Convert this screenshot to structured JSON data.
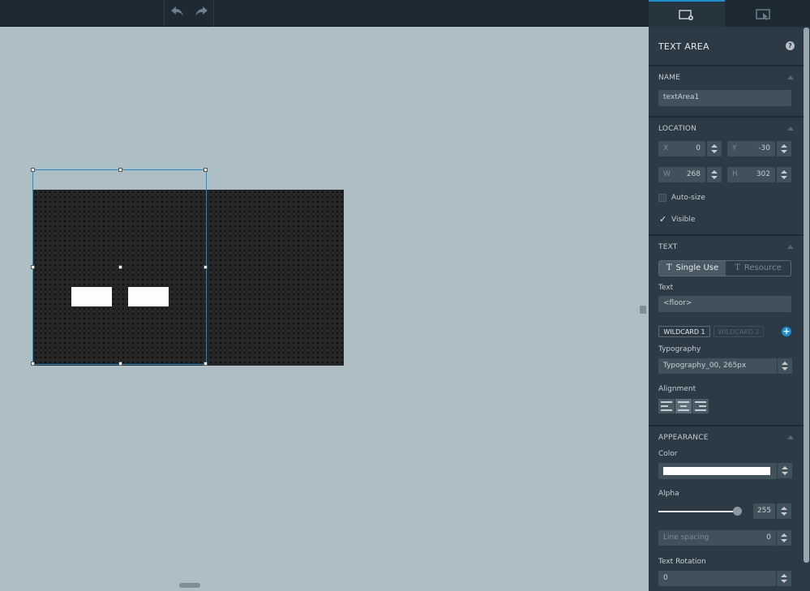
{
  "toolbar": {
    "undo_icon": "undo-arrow",
    "redo_icon": "redo-arrow"
  },
  "panel": {
    "tabs": [
      {
        "icon": "screen-settings-icon",
        "active": true
      },
      {
        "icon": "screen-interaction-icon",
        "active": false
      }
    ],
    "title": "TEXT AREA",
    "help_glyph": "?",
    "name_section": {
      "title": "NAME",
      "value": "textArea1"
    },
    "location_section": {
      "title": "LOCATION",
      "x_label": "X",
      "x_value": "0",
      "y_label": "Y",
      "y_value": "-30",
      "w_label": "W",
      "w_value": "268",
      "h_label": "H",
      "h_value": "302",
      "autosize_label": "Auto-size",
      "autosize_checked": false,
      "visible_label": "Visible",
      "visible_checked": true,
      "check_glyph": "✓"
    },
    "text_section": {
      "title": "TEXT",
      "single_use_label": "Single Use",
      "resource_label": "Resource",
      "text_label": "Text",
      "text_value": "<floor>",
      "wildcard1": "WILDCARD 1",
      "wildcard2": "WILDCARD 2",
      "add_glyph": "+",
      "typography_label": "Typography",
      "typography_value": "Typography_00,  265px",
      "alignment_label": "Alignment",
      "alignment_selected": "center"
    },
    "appearance_section": {
      "title": "APPEARANCE",
      "color_label": "Color",
      "color_value": "#ffffff",
      "alpha_label": "Alpha",
      "alpha_value": "255",
      "line_spacing_label": "Line spacing",
      "line_spacing_value": "0",
      "rotation_label": "Text Rotation",
      "rotation_value": "0"
    }
  },
  "colors": {
    "accent": "#1c8fd1",
    "canvas_bg": "#adbec4",
    "panel_bg": "#2b3a44"
  }
}
